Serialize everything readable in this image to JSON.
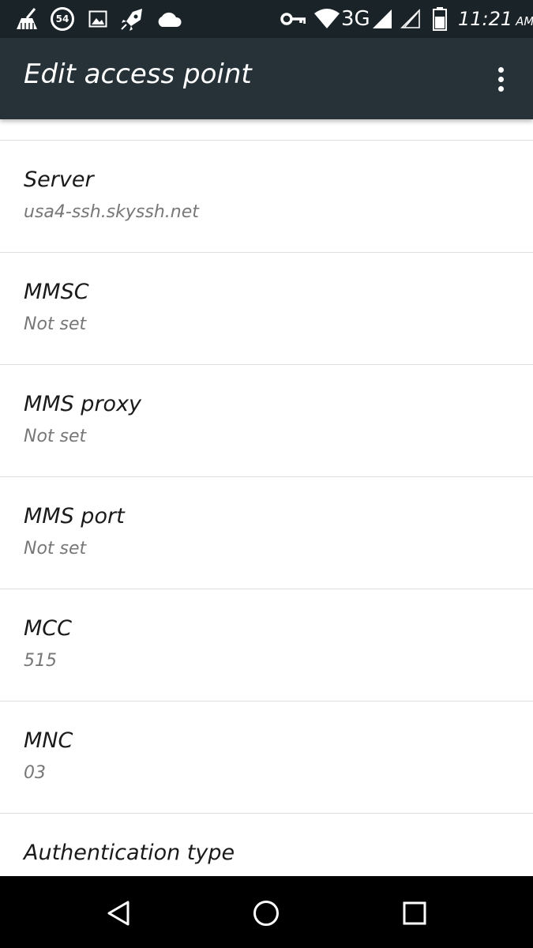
{
  "status_bar": {
    "icons": [
      "cleaner-icon",
      "notification-count-icon",
      "image-icon",
      "rocket-icon",
      "cloud-icon",
      "vpn-key-icon",
      "wifi-icon",
      "signal-icon",
      "signal-empty-icon",
      "battery-icon"
    ],
    "notification_count": "54",
    "network_type": "3G",
    "time": "11:21",
    "ampm": "AM"
  },
  "app_bar": {
    "title": "Edit access point",
    "menu_icon": "more-vert-icon"
  },
  "settings": [
    {
      "title": "Server",
      "value": "usa4-ssh.skyssh.net"
    },
    {
      "title": "MMSC",
      "value": "Not set"
    },
    {
      "title": "MMS proxy",
      "value": "Not set"
    },
    {
      "title": "MMS port",
      "value": "Not set"
    },
    {
      "title": "MCC",
      "value": "515"
    },
    {
      "title": "MNC",
      "value": "03"
    },
    {
      "title": "Authentication type",
      "value": ""
    }
  ],
  "nav_bar": {
    "icons": [
      "back-icon",
      "home-icon",
      "recents-icon"
    ]
  },
  "colors": {
    "status_bar": "#1a2428",
    "app_bar": "#263238",
    "nav_bar": "#000000",
    "title_text": "#1a1a1a",
    "value_text": "#777777",
    "divider": "#dedede"
  }
}
